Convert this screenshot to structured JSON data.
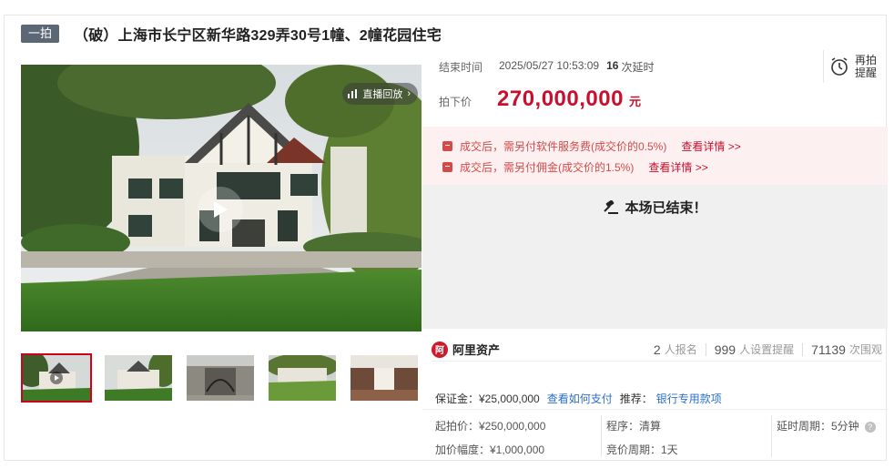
{
  "header": {
    "badge": "一拍",
    "title": "（破）上海市长宁区新华路329弄30号1幢、2幢花园住宅"
  },
  "media": {
    "live_replay_label": "直播回放",
    "thumbnail_count": 5,
    "active_thumbnail": 0
  },
  "auction": {
    "end_time_label": "结束时间",
    "end_time_value": "2025/05/27 10:53:09",
    "delay_count": "16",
    "delay_unit": "次延时",
    "remind_label": "再拍提醒",
    "final_price_label": "拍下价",
    "final_price": "270,000,000",
    "price_unit": "元",
    "notices": [
      {
        "text": "成交后，需另付软件服务费(成交价的0.5%)",
        "link": "查看详情 >>"
      },
      {
        "text": "成交后，需另付佣金(成交价的1.5%)",
        "link": "查看详情 >>"
      }
    ],
    "ended_text": "本场已结束！"
  },
  "platform": {
    "name": "阿里资产",
    "signups": "2",
    "signups_label": "人报名",
    "reminders": "999",
    "reminders_label": "人设置提醒",
    "viewers": "71139",
    "viewers_label": "次围观"
  },
  "details": {
    "deposit": "保证金：¥25,000,000",
    "deposit_link": "查看如何支付",
    "recommend_label": "推荐：",
    "recommend_link": "银行专用款项",
    "start_price": "起拍价：¥250,000,000",
    "procedure": "程序：清算",
    "delay_period": "延时周期：5分钟",
    "increment": "加价幅度：¥1,000,000",
    "bid_period": "竞价周期：1天"
  },
  "colors": {
    "accent_red": "#c8102e",
    "link_blue": "#2d6fcc",
    "badge_gray": "#5b6775",
    "notice_bg": "#fdf0f0"
  }
}
